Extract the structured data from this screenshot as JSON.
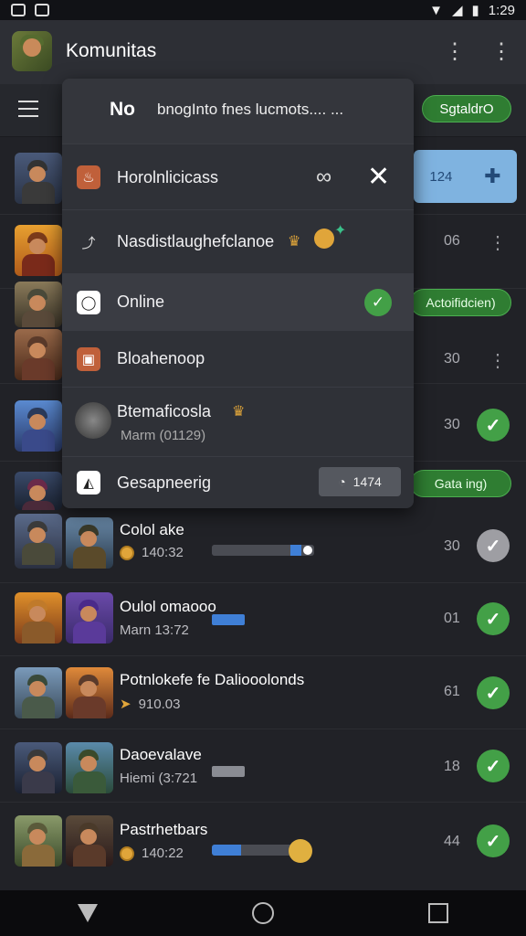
{
  "status_bar": {
    "time": "1:29"
  },
  "app_bar": {
    "title": "Komunitas",
    "menu_icon": "⋮"
  },
  "sub_bar": {
    "filter_label": "SgtaldrO"
  },
  "popup": {
    "header": {
      "prefix": "No",
      "text": "bnogInto fnes lucmots.... ..."
    },
    "items": [
      {
        "label": "Horolnlicicass",
        "icon": "fire-icon",
        "color": "#c0603a"
      },
      {
        "label": "Nasdistlaughefclanoe",
        "icon": "link-icon"
      },
      {
        "label": "Online",
        "icon": "circle-icon"
      },
      {
        "label": "Bloahenoop",
        "icon": "badge-icon",
        "color": "#c0603a"
      },
      {
        "label": "Btemaficosla",
        "sublabel": "Marm (01129)",
        "icon": "avatar-icon"
      },
      {
        "label": "Gesapneerig",
        "icon": "flag-icon",
        "badge": "1474"
      }
    ]
  },
  "side_pills": {
    "online": "Actoifidcien)",
    "gesap": "Gata ing)"
  },
  "blue_card": {
    "value": "124",
    "icon": "plus-icon"
  },
  "rows": [
    {
      "num": "",
      "kebab": true
    },
    {
      "num": "06",
      "kebab": true
    },
    {
      "num": "",
      "kebab": false
    },
    {
      "num": "30",
      "kebab": true
    },
    {
      "num": "30",
      "check": true
    },
    {
      "num": "",
      "check": false
    },
    {
      "name": "Colol ake",
      "sub": "140:32",
      "progress": 0.85,
      "num": "30",
      "check": "grey"
    },
    {
      "name": "Oulol omaooo",
      "sub": "Marn 13:72",
      "num": "01",
      "check": "green"
    },
    {
      "name": "Potnlokefe fe Daliooolonds",
      "sub": "910.03",
      "num": "61",
      "check": "green"
    },
    {
      "name": "Daoevalave",
      "sub": "Hiemi (3:721",
      "num": "18",
      "check": "green"
    },
    {
      "name": "Pastrhetbars",
      "sub": "140:22",
      "progress": 0.35,
      "num": "44",
      "check": "green"
    }
  ]
}
